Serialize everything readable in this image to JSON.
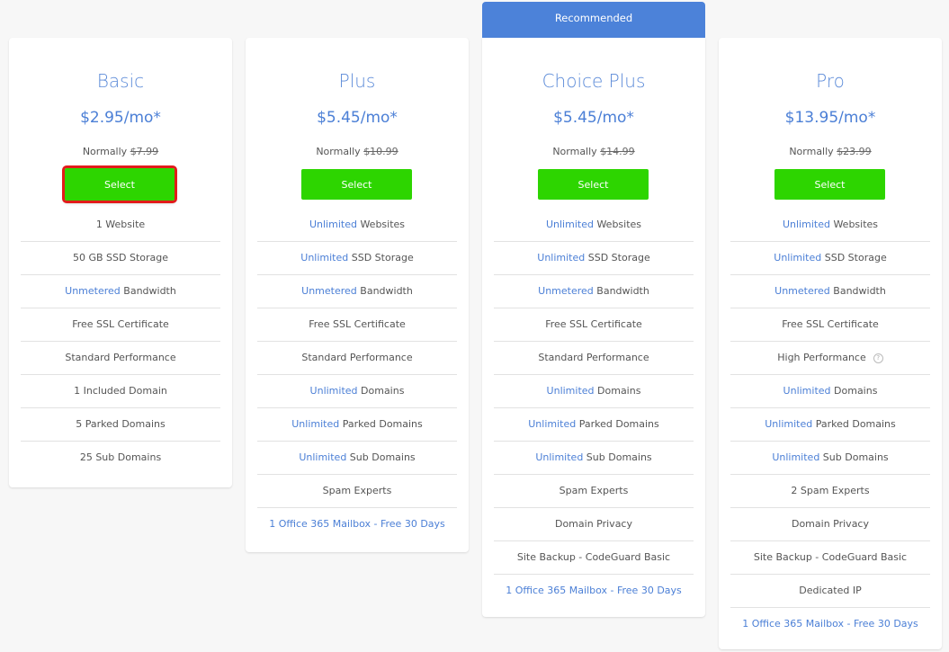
{
  "recommended_label": "Recommended",
  "plans": [
    {
      "name": "Basic",
      "price": "$2.95/mo*",
      "normally_label": "Normally",
      "normal_price": "$7.99",
      "select_label": "Select",
      "features": [
        {
          "prefix": "",
          "text": "1 Website"
        },
        {
          "prefix": "",
          "text": "50 GB SSD Storage"
        },
        {
          "prefix": "Unmetered",
          "text": " Bandwidth"
        },
        {
          "prefix": "",
          "text": "Free SSL Certificate"
        },
        {
          "prefix": "",
          "text": "Standard Performance"
        },
        {
          "prefix": "",
          "text": "1 Included Domain"
        },
        {
          "prefix": "",
          "text": "5 Parked Domains"
        },
        {
          "prefix": "",
          "text": "25 Sub Domains"
        }
      ]
    },
    {
      "name": "Plus",
      "price": "$5.45/mo*",
      "normally_label": "Normally",
      "normal_price": "$10.99",
      "select_label": "Select",
      "features": [
        {
          "prefix": "Unlimited",
          "text": " Websites"
        },
        {
          "prefix": "Unlimited",
          "text": " SSD Storage"
        },
        {
          "prefix": "Unmetered",
          "text": " Bandwidth"
        },
        {
          "prefix": "",
          "text": "Free SSL Certificate"
        },
        {
          "prefix": "",
          "text": "Standard Performance"
        },
        {
          "prefix": "Unlimited",
          "text": " Domains"
        },
        {
          "prefix": "Unlimited",
          "text": " Parked Domains"
        },
        {
          "prefix": "Unlimited",
          "text": " Sub Domains"
        },
        {
          "prefix": "",
          "text": "Spam Experts"
        },
        {
          "link": "1 Office 365 Mailbox - Free 30 Days"
        }
      ]
    },
    {
      "name": "Choice Plus",
      "price": "$5.45/mo*",
      "normally_label": "Normally",
      "normal_price": "$14.99",
      "select_label": "Select",
      "features": [
        {
          "prefix": "Unlimited",
          "text": " Websites"
        },
        {
          "prefix": "Unlimited",
          "text": " SSD Storage"
        },
        {
          "prefix": "Unmetered",
          "text": " Bandwidth"
        },
        {
          "prefix": "",
          "text": "Free SSL Certificate"
        },
        {
          "prefix": "",
          "text": "Standard Performance"
        },
        {
          "prefix": "Unlimited",
          "text": " Domains"
        },
        {
          "prefix": "Unlimited",
          "text": " Parked Domains"
        },
        {
          "prefix": "Unlimited",
          "text": " Sub Domains"
        },
        {
          "prefix": "",
          "text": "Spam Experts"
        },
        {
          "prefix": "",
          "text": "Domain Privacy"
        },
        {
          "prefix": "",
          "text": "Site Backup - CodeGuard Basic"
        },
        {
          "link": "1 Office 365 Mailbox - Free 30 Days"
        }
      ]
    },
    {
      "name": "Pro",
      "price": "$13.95/mo*",
      "normally_label": "Normally",
      "normal_price": "$23.99",
      "select_label": "Select",
      "features": [
        {
          "prefix": "Unlimited",
          "text": " Websites"
        },
        {
          "prefix": "Unlimited",
          "text": " SSD Storage"
        },
        {
          "prefix": "Unmetered",
          "text": " Bandwidth"
        },
        {
          "prefix": "",
          "text": "Free SSL Certificate"
        },
        {
          "prefix": "",
          "text": "High Performance",
          "help_icon": "question-circle-icon",
          "help_glyph": "?"
        },
        {
          "prefix": "Unlimited",
          "text": " Domains"
        },
        {
          "prefix": "Unlimited",
          "text": " Parked Domains"
        },
        {
          "prefix": "Unlimited",
          "text": " Sub Domains"
        },
        {
          "prefix": "",
          "text": "2 Spam Experts"
        },
        {
          "prefix": "",
          "text": "Domain Privacy"
        },
        {
          "prefix": "",
          "text": "Site Backup - CodeGuard Basic"
        },
        {
          "prefix": "",
          "text": "Dedicated IP"
        },
        {
          "link": "1 Office 365 Mailbox - Free 30 Days"
        }
      ]
    }
  ],
  "colors": {
    "accent": "#4b7fd6",
    "recommended_banner": "#4c82d9",
    "select_button": "#2dd500",
    "highlight_outline": "#e21b1b"
  }
}
